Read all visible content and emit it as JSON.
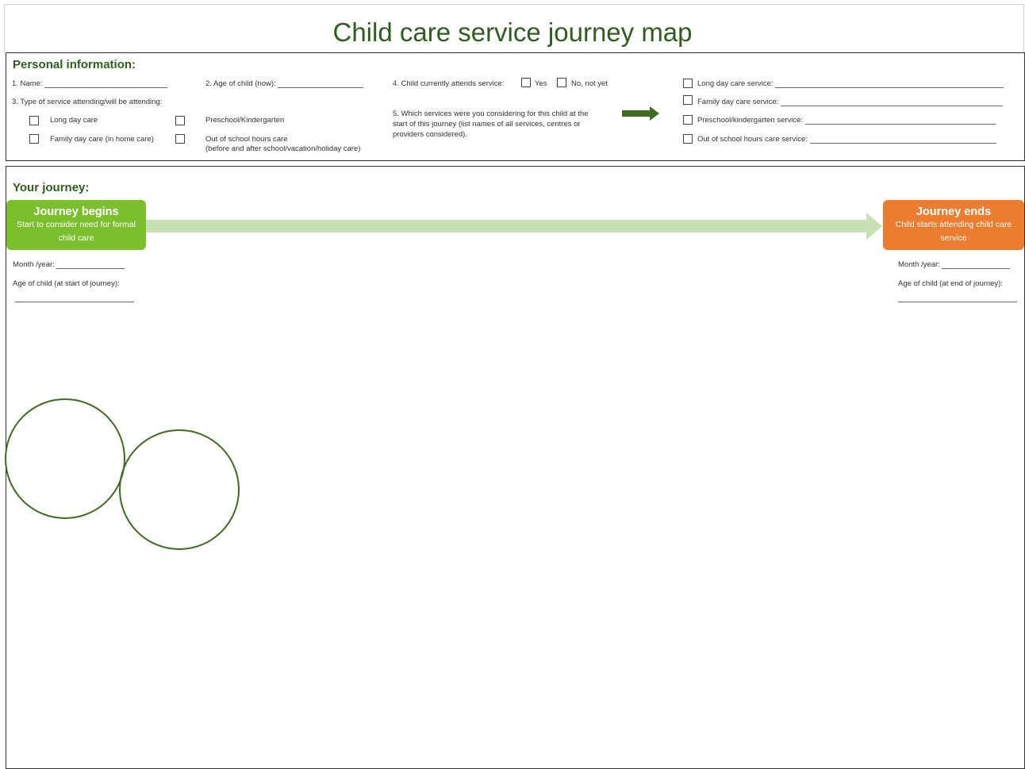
{
  "title": "Child care service journey map",
  "personal": {
    "heading": "Personal information:",
    "name_label": "1. Name:",
    "age_label": "2. Age of child (now):",
    "type_label": "3. Type of service attending/will be attending:",
    "types": {
      "long_day": "Long day care",
      "family_day": "Family day care (in home care)",
      "preschool": "Preschool/Kindergarten",
      "oshc_line1": "Out of school hours care",
      "oshc_line2": "(before and after school/vacation/holiday care)"
    },
    "attends_label": "4. Child currently attends service:",
    "attends_yes": "Yes",
    "attends_no": "No, not yet",
    "considering_line1": "5. Which services were you considering for this child at the",
    "considering_line2": "start of this journey (list names of all services, centres or",
    "considering_line3": "providers considered).",
    "services": {
      "long_day": "Long day care service:",
      "family_day": "Family day care service:",
      "preschool": "Preschool/kindergarten service:",
      "oshc": "Out of school hours care service:"
    },
    "colors": {
      "dark_green": "#3d6b21"
    }
  },
  "journey": {
    "heading": "Your journey:",
    "begins": {
      "title": "Journey begins",
      "sub": "Start to consider need for formal child care",
      "color": "#7bbf2f"
    },
    "ends": {
      "title": "Journey ends",
      "sub": "Child starts attending child care service",
      "color": "#ec7c30"
    },
    "arrow_color": "#c5e0b4",
    "month_year_label": "Month /year:",
    "age_start_label": "Age of child (at start of journey):",
    "age_end_label": "Age of child (at end of journey):"
  }
}
